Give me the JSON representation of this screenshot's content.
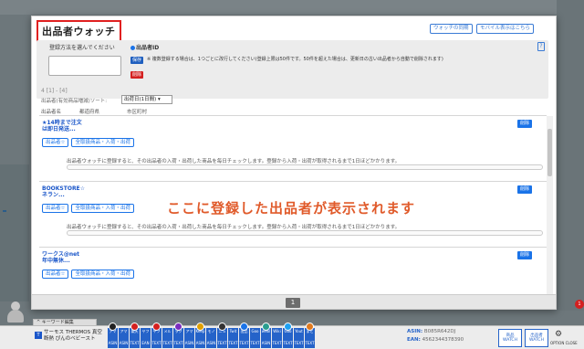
{
  "modal": {
    "title": "出品者ウォッチ",
    "header_buttons": [
      "ウォッチの同期",
      "モバイル表示はこちら"
    ],
    "register": {
      "method_label": "登録方法を選んでください",
      "radio_label": "出品者ID",
      "save_label": "保存",
      "delete_label": "削除",
      "note": "※ 複数登録する場合は、1つごとに改行してください(登録上限は50件です。50件を超えた場合は、更新日の古い出品者から自動で削除されます)",
      "help": "?"
    },
    "count_text": "4 [1] - [4]",
    "sort_label": "出品者(有効商品増減)ソート:",
    "sort_value": "出荷日(1日間)",
    "columns": [
      "出品者名",
      "都道府県",
      "市区町村"
    ],
    "sellers": [
      {
        "name_line1": "★14時まで注文",
        "name_line2": "は即日発送...",
        "chips": [
          "出品者☆",
          "全取扱商品・入荷・出荷"
        ],
        "delete": "削除",
        "desc": "出品者ウォッチに登録すると、その出品者の入荷・出荷した商品を毎日チェックします。登録から入荷・出荷が取得されるまで1日ほどかかります。"
      },
      {
        "name_line1": "BOOKSTORE☆",
        "name_line2": "ネラン...",
        "chips": [
          "出品者☆",
          "全取扱商品・入荷・出荷"
        ],
        "delete": "削除",
        "desc": "出品者ウォッチに登録すると、その出品者の入荷・出荷した商品を毎日チェックします。登録から入荷・出荷が取得されるまで1日ほどかかります。"
      },
      {
        "name_line1": "ワークス@net",
        "name_line2": "年中無休...",
        "chips": [
          "出品者☆",
          "全取扱商品・入荷・出荷"
        ],
        "delete": "削除",
        "desc": ""
      }
    ],
    "overlay_text": "ここに登録した出品者が表示されます",
    "page_number": "1"
  },
  "toolbar": {
    "keyword_label": "^ キーワード編集",
    "product_tag": "T",
    "product_title": "サーモス THERMOS 真空断熱 ぴんのベビースト",
    "shortcut_buttons": [
      {
        "top": "アマ",
        "bottom": "ASIN"
      },
      {
        "top": "アマ",
        "bottom": "ASIN"
      },
      {
        "top": "楽天",
        "bottom": "TEXT"
      },
      {
        "top": "ヤフ",
        "bottom": "EAN"
      },
      {
        "top": "ヤフ",
        "bottom": "TEXT"
      },
      {
        "top": "メル",
        "bottom": "TEXT"
      },
      {
        "top": "ラク",
        "bottom": "TEXT"
      },
      {
        "top": "アマ",
        "bottom": "ASIN"
      },
      {
        "top": "Keep",
        "bottom": "ASIN"
      },
      {
        "top": "モノ",
        "bottom": "ASIN"
      },
      {
        "top": "ニュ",
        "bottom": "TEXT"
      },
      {
        "top": "Twit",
        "bottom": "TEXT"
      },
      {
        "top": "出品",
        "bottom": "TEXT"
      },
      {
        "top": "Goo",
        "bottom": "TEXT"
      },
      {
        "top": "webl",
        "bottom": "ASIN"
      },
      {
        "top": "Wiki",
        "bottom": "TEXT"
      },
      {
        "top": "Goo",
        "bottom": "TEXT"
      },
      {
        "top": "Yout",
        "bottom": "TEXT"
      },
      {
        "top": "まと",
        "bottom": "TEXT"
      }
    ],
    "asin_label": "ASIN:",
    "asin_value": "B085R642DJ",
    "ean_label": "EAN:",
    "ean_value": "4562344378390",
    "watch_buttons": [
      "商品 WATCH",
      "出品者 WATCH"
    ],
    "option_label": "OPTION CLOSE",
    "notification_count": "1"
  },
  "colors": {
    "accent": "#1a73e8",
    "alert": "#e02020",
    "overlay_text": "#e05a2a"
  }
}
